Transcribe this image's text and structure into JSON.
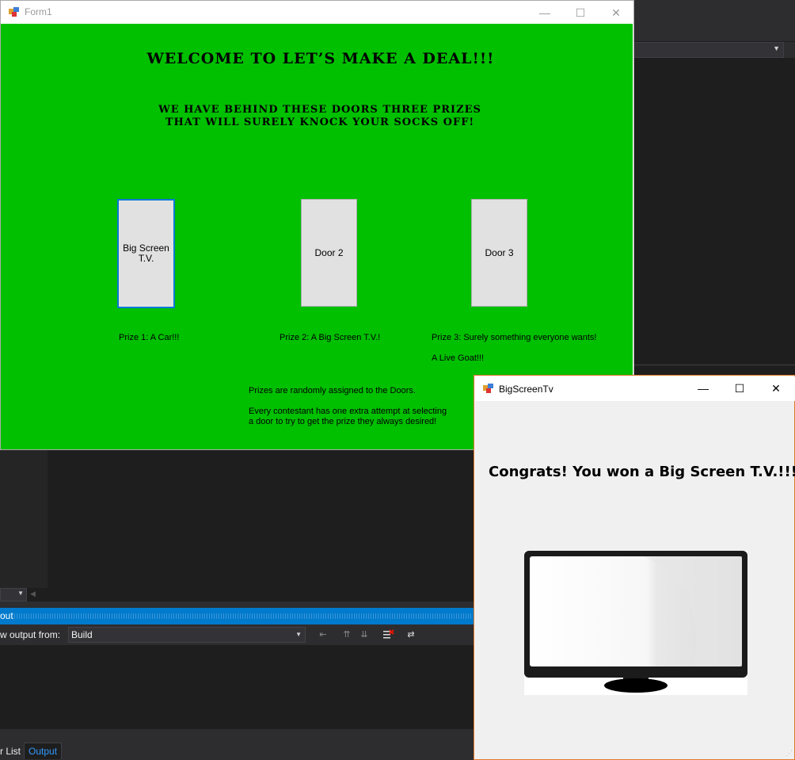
{
  "form1": {
    "title": "Form1",
    "headline": "Welcome to Let’s Make a Deal!!!",
    "subhead_line1": "We have behind these doors three prizes",
    "subhead_line2": "that will surely knock your socks off!",
    "doors": [
      {
        "label_line1": "Big Screen",
        "label_line2": "T.V."
      },
      {
        "label": "Door 2"
      },
      {
        "label": "Door 3"
      }
    ],
    "prizes": [
      "Prize 1: A Car!!!",
      "Prize 2: A Big Screen T.V.!",
      "Prize 3: Surely something everyone wants!"
    ],
    "prize3_detail": "A Live Goat!!!",
    "info_line1": "Prizes are randomly assigned to the Doors.",
    "info_line2": "Every contestant has one extra attempt at selecting",
    "info_line3": "a door to try to get the prize they always desired!",
    "background_color": "#00c000"
  },
  "bigscreen": {
    "title": "BigScreenTv",
    "message": "Congrats! You won a Big Screen T.V.!!!",
    "image": "big-screen-tv-illustration"
  },
  "vs": {
    "output_title": "out",
    "show_output_label": "w output from:",
    "build_source": "Build",
    "tab_error_list": "r List",
    "tab_output": "Output"
  }
}
